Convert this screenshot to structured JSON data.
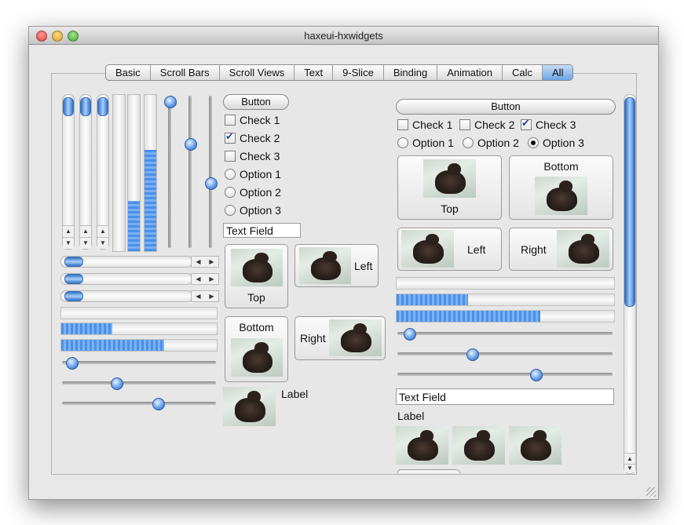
{
  "window": {
    "title": "haxeui-hxwidgets",
    "colors": {
      "close": "#ff5f57",
      "minimize": "#febc2e",
      "zoom": "#28c840",
      "accent": "#5b9be8"
    }
  },
  "tabs": [
    {
      "label": "Basic"
    },
    {
      "label": "Scroll Bars"
    },
    {
      "label": "Scroll Views"
    },
    {
      "label": "Text"
    },
    {
      "label": "9-Slice"
    },
    {
      "label": "Binding"
    },
    {
      "label": "Animation"
    },
    {
      "label": "Calc"
    },
    {
      "label": "All",
      "active": true
    }
  ],
  "left": {
    "vertical_progress": [
      0.32,
      0.65
    ],
    "vertical_sliders": [
      1.0,
      0.7,
      0.42
    ],
    "horizontal_progress": [
      0.0,
      0.33,
      0.66
    ],
    "horizontal_sliders": [
      0.03,
      0.34,
      0.63
    ]
  },
  "middle": {
    "button_label": "Button",
    "checks": [
      {
        "label": "Check 1",
        "checked": false
      },
      {
        "label": "Check 2",
        "checked": true
      },
      {
        "label": "Check 3",
        "checked": false
      }
    ],
    "options": [
      {
        "label": "Option 1",
        "selected": false
      },
      {
        "label": "Option 2",
        "selected": false
      },
      {
        "label": "Option 3",
        "selected": false
      }
    ],
    "text_field": "Text Field",
    "image_buttons": {
      "top": "Top",
      "left": "Left",
      "bottom": "Bottom",
      "right": "Right"
    },
    "label": "Label"
  },
  "right": {
    "button_label": "Button",
    "checks": [
      {
        "label": "Check 1",
        "checked": false
      },
      {
        "label": "Check 2",
        "checked": false
      },
      {
        "label": "Check 3",
        "checked": true
      }
    ],
    "options": [
      {
        "label": "Option 1",
        "selected": false
      },
      {
        "label": "Option 2",
        "selected": false
      },
      {
        "label": "Option 3",
        "selected": true
      }
    ],
    "image_buttons": {
      "top": "Top",
      "bottom": "Bottom",
      "left": "Left",
      "right": "Right"
    },
    "horizontal_progress": [
      0.0,
      0.33,
      0.66
    ],
    "horizontal_sliders": [
      0.03,
      0.34,
      0.65
    ],
    "text_field": "Text Field",
    "label": "Label"
  }
}
